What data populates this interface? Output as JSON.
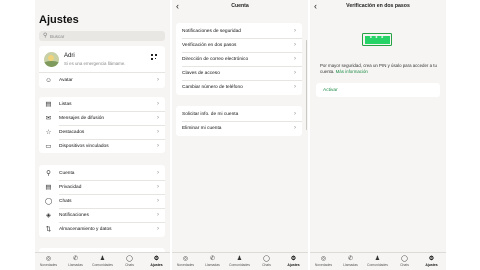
{
  "settings": {
    "title": "Ajustes",
    "search_placeholder": "Buscar",
    "profile": {
      "name": "Adri",
      "status": "Si es una emergencia llámame."
    },
    "avatar_label": "Avatar",
    "group1": [
      "Listas",
      "Mensajes de difusión",
      "Destacados",
      "Dispositivos vinculados"
    ],
    "group2": [
      "Cuenta",
      "Privacidad",
      "Chats",
      "Notificaciones",
      "Almacenamiento y datos"
    ]
  },
  "account": {
    "title": "Cuenta",
    "group1": [
      "Notificaciones de seguridad",
      "Verificación en dos pasos",
      "Dirección de correo electrónico",
      "Claves de acceso",
      "Cambiar número de teléfono"
    ],
    "group2": [
      "Solicitar info. de mi cuenta",
      "Eliminar mi cuenta"
    ]
  },
  "two_step": {
    "title": "Verificación en dos pasos",
    "pin_glyph": "* * *",
    "description": "Por mayor seguridad, crea un PIN y úsalo para acceder a tu cuenta.",
    "more_info": "Más información",
    "activate": "Activar"
  },
  "tabbar": [
    {
      "label": "Novedades",
      "icon": "updates-icon"
    },
    {
      "label": "Llamadas",
      "icon": "phone-icon"
    },
    {
      "label": "Comunidades",
      "icon": "communities-icon"
    },
    {
      "label": "Chats",
      "icon": "chats-icon"
    },
    {
      "label": "Ajustes",
      "icon": "settings-icon"
    }
  ],
  "icons": {
    "Listas": "list-icon",
    "Mensajes de difusión": "megaphone-icon",
    "Destacados": "star-icon",
    "Dispositivos vinculados": "laptop-icon",
    "Cuenta": "key-icon",
    "Privacidad": "lock-icon",
    "Chats": "chat-icon",
    "Notificaciones": "bell-icon",
    "Almacenamiento y datos": "storage-icon",
    "Avatar": "avatar-icon"
  },
  "colors": {
    "accent": "#25d366",
    "link": "#1b8a44",
    "background": "#f6f5f3"
  }
}
